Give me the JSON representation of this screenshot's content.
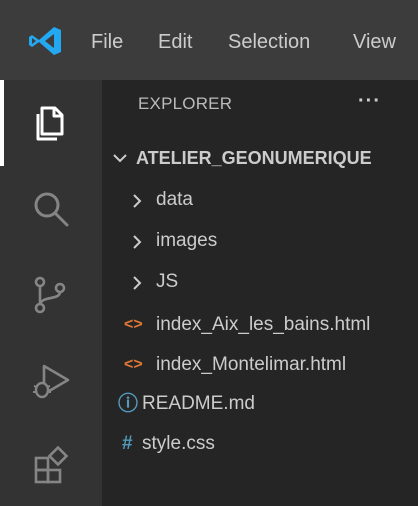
{
  "menu": {
    "file": "File",
    "edit": "Edit",
    "selection": "Selection",
    "view": "View"
  },
  "activity_bar": {
    "items": [
      {
        "name": "explorer",
        "icon": "files-icon",
        "active": true
      },
      {
        "name": "search",
        "icon": "search-icon",
        "active": false
      },
      {
        "name": "source-control",
        "icon": "source-control-icon",
        "active": false
      },
      {
        "name": "run-and-debug",
        "icon": "run-debug-icon",
        "active": false
      },
      {
        "name": "extensions",
        "icon": "extensions-icon",
        "active": false
      }
    ]
  },
  "explorer": {
    "title": "EXPLORER",
    "more_actions": "···",
    "root": {
      "label": "ATELIER_GEONUMERIQUE",
      "expanded": true
    },
    "folders": [
      {
        "label": "data",
        "expanded": false
      },
      {
        "label": "images",
        "expanded": false
      },
      {
        "label": "JS",
        "expanded": false
      }
    ],
    "files": [
      {
        "label": "index_Aix_les_bains.html",
        "icon": "html-icon",
        "glyph": "<>",
        "color": "#e37933"
      },
      {
        "label": "index_Montelimar.html",
        "icon": "html-icon",
        "glyph": "<>",
        "color": "#e37933"
      },
      {
        "label": "README.md",
        "icon": "info-icon",
        "glyph": "ⓘ",
        "color": "#519aba"
      },
      {
        "label": "style.css",
        "icon": "hash-icon",
        "glyph": "#",
        "color": "#519aba"
      }
    ]
  },
  "colors": {
    "titlebar": "#3c3c3c",
    "activitybar": "#333333",
    "sidebar": "#252526",
    "vscode_blue": "#23a9f2",
    "text": "#cccccc",
    "html_icon": "#e37933",
    "info_icon": "#519aba"
  }
}
